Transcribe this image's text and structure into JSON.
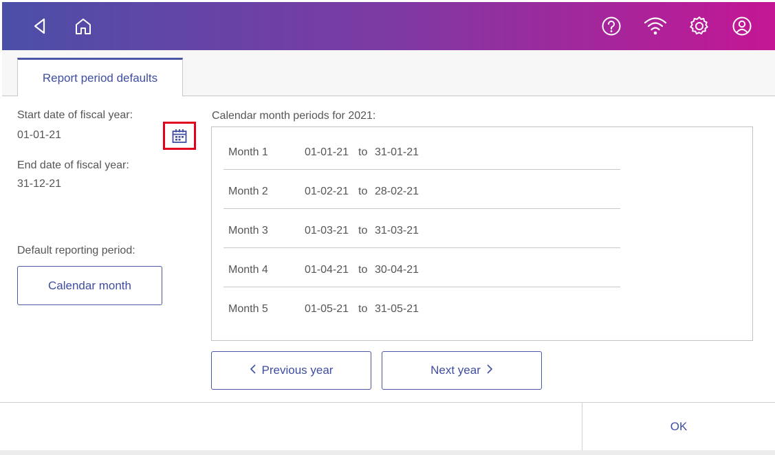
{
  "header": {
    "icons": [
      "back-icon",
      "home-icon",
      "help-icon",
      "wifi-icon",
      "settings-icon",
      "account-icon"
    ],
    "gradient_start": "#4b4fa8",
    "gradient_end": "#c41694"
  },
  "tabs": [
    {
      "label": "Report period defaults",
      "active": true
    }
  ],
  "fiscal": {
    "start_label": "Start date of fiscal year:",
    "start_value": "01-01-21",
    "end_label": "End date of fiscal year:",
    "end_value": "31-12-21"
  },
  "reporting": {
    "label": "Default reporting period:",
    "button_label": "Calendar month"
  },
  "periods": {
    "title": "Calendar month periods for  2021:",
    "rows": [
      {
        "month": "Month 1",
        "from": "01-01-21",
        "to_word": "to",
        "to": "31-01-21"
      },
      {
        "month": "Month 2",
        "from": "01-02-21",
        "to_word": "to",
        "to": "28-02-21"
      },
      {
        "month": "Month 3",
        "from": "01-03-21",
        "to_word": "to",
        "to": "31-03-21"
      },
      {
        "month": "Month 4",
        "from": "01-04-21",
        "to_word": "to",
        "to": "30-04-21"
      },
      {
        "month": "Month 5",
        "from": "01-05-21",
        "to_word": "to",
        "to": "31-05-21"
      }
    ]
  },
  "navigation": {
    "previous_label": "Previous year",
    "next_label": "Next year"
  },
  "footer": {
    "ok_label": "OK"
  },
  "colors": {
    "accent": "#3e4da0",
    "highlight": "#e0001b"
  }
}
